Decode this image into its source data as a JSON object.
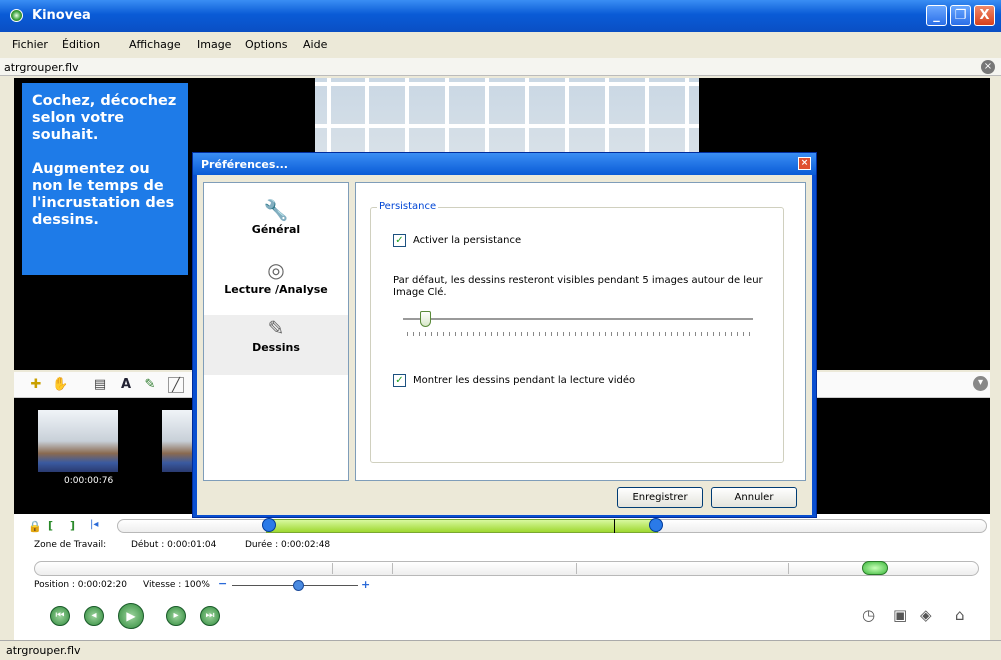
{
  "window": {
    "title": "Kinovea",
    "minimize": "_",
    "maximize": "❐",
    "close": "X"
  },
  "menu": [
    "Fichier",
    "Édition",
    "Affichage",
    "Image",
    "Options",
    "Aide"
  ],
  "document": {
    "name": "atrgrouper.flv",
    "close": "×"
  },
  "tooltip": {
    "lines": [
      "Cochez, décochez selon votre souhait.",
      "Augmentez ou non le temps de l'incrustation des dessins."
    ]
  },
  "keyframe": {
    "time": "0:00:00:76"
  },
  "playback": {
    "work_zone_label": "Zone de Travail:",
    "start": "Début : 0:00:01:04",
    "duration": "Durée : 0:00:02:48",
    "position": "Position : 0:00:02:20",
    "speed": "Vitesse : 100%"
  },
  "status": {
    "text": "atrgrouper.flv"
  },
  "dialog": {
    "title": "Préférences...",
    "close": "×",
    "categories": [
      "Général",
      "Lecture /Analyse",
      "Dessins"
    ],
    "group_title": "Persistance",
    "checkbox_persist": "Activer la persistance",
    "description": "Par défaut, les dessins resteront visibles pendant 5 images autour de leur Image Clé.",
    "checkbox_play": "Montrer les dessins pendant la lecture vidéo",
    "persist_checked": true,
    "play_checked": true,
    "slider_value": 5,
    "save_label": "Enregistrer",
    "cancel_label": "Annuler"
  },
  "colors": {
    "titlebar": "#0a5bd6",
    "tooltip": "#1e7be8",
    "work_range": "#9fd830"
  },
  "icons": [
    "wrench-icon",
    "film-reel-icon",
    "brushes-icon",
    "play-icon",
    "camera-icon"
  ]
}
